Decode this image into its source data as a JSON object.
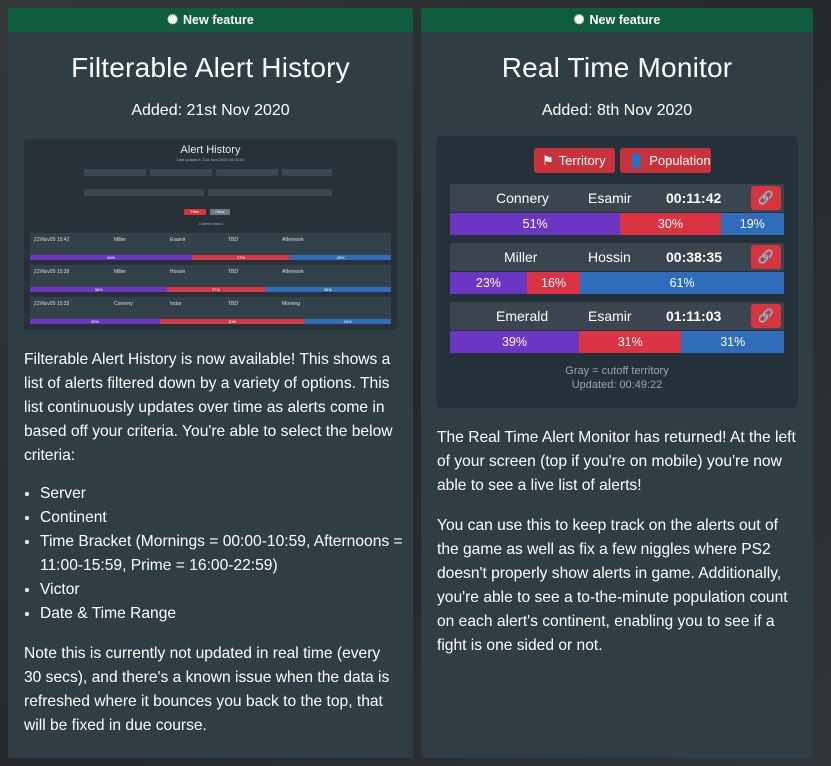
{
  "left": {
    "badge": "New feature",
    "title": "Filterable Alert History",
    "added": "Added: 21st Nov 2020",
    "mini": {
      "title": "Alert History",
      "subtitle": "Last updated: 21st Nov 2020 16:02:00",
      "filter_label": "Filter",
      "clear_label": "Clear",
      "found": "3 alerts found",
      "rows": [
        {
          "date": "21\\Nov20 15:42",
          "victor": "Miller",
          "continent": "Esamir",
          "bracket": "TBD",
          "time": "Afternoon",
          "vs": "45%",
          "tr": "27%",
          "nc": "28%"
        },
        {
          "date": "21\\Nov20 15:39",
          "victor": "Miller",
          "continent": "Hossin",
          "bracket": "TBD",
          "time": "Afternoon",
          "vs": "38%",
          "tr": "27%",
          "nc": "35%"
        },
        {
          "date": "21\\Nov20 15:33",
          "victor": "Connery",
          "continent": "Indar",
          "bracket": "TBD",
          "time": "Morning",
          "vs": "36%",
          "tr": "40%",
          "nc": "24%"
        }
      ]
    },
    "intro": "Filterable Alert History is now available! This shows a list of alerts filtered down by a variety of options. This list continuously updates over time as alerts come in based off your criteria. You're able to select the below criteria:",
    "criteria": [
      "Server",
      "Continent",
      "Time Bracket (Mornings = 00:00-10:59, Afternoons = 11:00-15:59, Prime = 16:00-22:59)",
      "Victor",
      "Date & Time Range"
    ],
    "note": "Note this is currently not updated in real time (every 30 secs), and there's a known issue when the data is refreshed where it bounces you back to the top, that will be fixed in due course."
  },
  "right": {
    "badge": "New feature",
    "title": "Real Time Monitor",
    "added": "Added: 8th Nov 2020",
    "tabs": {
      "territory": "Territory",
      "population": "Population"
    },
    "alerts": [
      {
        "server": "Connery",
        "continent": "Esamir",
        "time": "00:11:42",
        "vs": "51%",
        "tr": "30%",
        "nc": "19%",
        "vs_v": 51,
        "tr_v": 30,
        "nc_v": 19
      },
      {
        "server": "Miller",
        "continent": "Hossin",
        "time": "00:38:35",
        "vs": "23%",
        "tr": "16%",
        "nc": "61%",
        "vs_v": 23,
        "tr_v": 16,
        "nc_v": 61
      },
      {
        "server": "Emerald",
        "continent": "Esamir",
        "time": "01:11:03",
        "vs": "39%",
        "tr": "31%",
        "nc": "31%",
        "vs_v": 39,
        "tr_v": 31,
        "nc_v": 31
      }
    ],
    "footer_note": "Gray = cutoff territory",
    "footer_updated": "Updated: 00:49:22",
    "para1": "The Real Time Alert Monitor has returned! At the left of your screen (top if you're on mobile) you're now able to see a live list of alerts!",
    "para2": "You can use this to keep track on the alerts out of the game as well as fix a few niggles where PS2 doesn't properly show alerts in game. Additionally, you're able to see a to-the-minute population count on each alert's continent, enabling you to see if a fight is one sided or not."
  },
  "colors": {
    "ribbon": "#0f5c3f",
    "vs": "#6c35c4",
    "tr": "#da3344",
    "nc": "#2f6cba",
    "button": "#d9343e"
  }
}
